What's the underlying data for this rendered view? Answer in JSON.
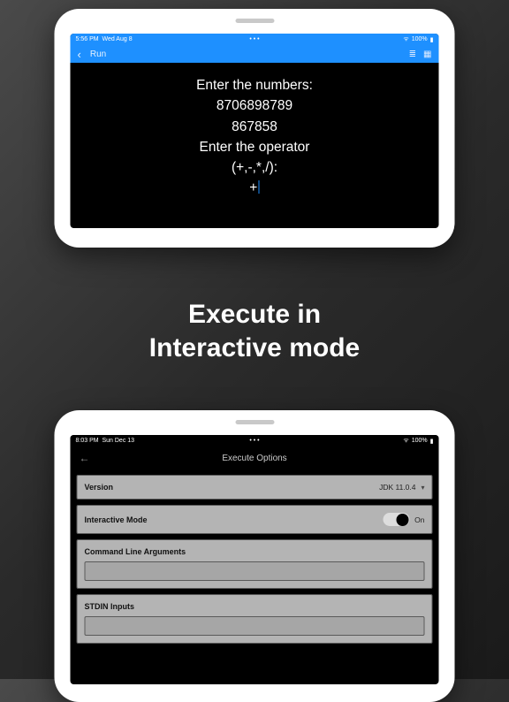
{
  "top": {
    "status_time": "5:56 PM",
    "status_date": "Wed Aug 8",
    "battery_pct": "100%",
    "nav_title": "Run",
    "console_lines": {
      "l1": "Enter the numbers:",
      "l2": "8706898789",
      "l3": "867858",
      "l4": "Enter the operator",
      "l5": "(+,-,*,/):",
      "l6": "+"
    }
  },
  "caption": {
    "line1": "Execute in",
    "line2": "Interactive mode"
  },
  "bottom": {
    "status_time": "8:03 PM",
    "status_date": "Sun Dec 13",
    "battery_pct": "100%",
    "nav_title": "Execute Options",
    "rows": {
      "version_label": "Version",
      "version_value": "JDK 11.0.4",
      "interactive_label": "Interactive Mode",
      "interactive_value": "On",
      "cli_label": "Command Line Arguments",
      "stdin_label": "STDIN Inputs"
    }
  }
}
